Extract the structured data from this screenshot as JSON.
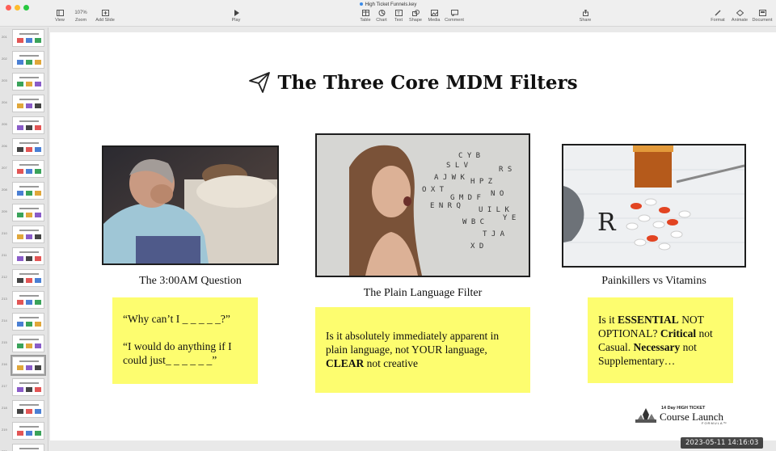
{
  "window": {
    "title": "High Ticket Funnels.key"
  },
  "toolbar": {
    "view_label": "View",
    "zoom_value": "107%",
    "zoom_label": "Zoom",
    "add_slide_label": "Add Slide",
    "play_label": "Play",
    "table_label": "Table",
    "chart_label": "Chart",
    "text_label": "Text",
    "shape_label": "Shape",
    "media_label": "Media",
    "comment_label": "Comment",
    "share_label": "Share",
    "format_label": "Format",
    "animate_label": "Animate",
    "document_label": "Document"
  },
  "sidebar": {
    "slides": [
      {
        "number": "201",
        "selected": false
      },
      {
        "number": "202",
        "selected": false
      },
      {
        "number": "203",
        "selected": false
      },
      {
        "number": "204",
        "selected": false
      },
      {
        "number": "205",
        "selected": false
      },
      {
        "number": "206",
        "selected": false
      },
      {
        "number": "207",
        "selected": false
      },
      {
        "number": "208",
        "selected": false
      },
      {
        "number": "209",
        "selected": false
      },
      {
        "number": "210",
        "selected": false
      },
      {
        "number": "211",
        "selected": false
      },
      {
        "number": "212",
        "selected": false
      },
      {
        "number": "213",
        "selected": false
      },
      {
        "number": "214",
        "selected": false
      },
      {
        "number": "215",
        "selected": false
      },
      {
        "number": "216",
        "selected": true
      },
      {
        "number": "217",
        "selected": false
      },
      {
        "number": "218",
        "selected": false
      },
      {
        "number": "219",
        "selected": false
      },
      {
        "number": "220",
        "selected": false
      }
    ]
  },
  "slide": {
    "title": "The Three Core MDM Filters",
    "columns": [
      {
        "image": "man-awake-at-night-photo",
        "caption": "The 3:00AM Question",
        "note_lines": [
          "“Why can’t I _ _ _ _ _?”",
          "“I would do anything if I could just_ _ _ _ _ _”"
        ]
      },
      {
        "image": "woman-speaking-letters-photo",
        "caption": "The Plain Language Filter",
        "note_text_1": "Is it absolutely immediately apparent in plain language, not YOUR language, ",
        "note_bold_1": "CLEAR",
        "note_text_2": " not creative"
      },
      {
        "image": "pills-prescription-photo",
        "caption": "Painkillers vs Vitamins",
        "note_text_1": "Is it ",
        "note_bold_1": "ESSENTIAL",
        "note_text_2": " NOT OPTIONAL? ",
        "note_bold_2": "Critical",
        "note_text_3": " not Casual. ",
        "note_bold_3": "Necessary",
        "note_text_4": " not Supplementary…"
      }
    ],
    "brand": {
      "top": "14 Day HIGH TICKET",
      "main": "Course Launch",
      "sub": "FORMULA™"
    }
  },
  "timestamp": "2023-05-11  14:16:03"
}
